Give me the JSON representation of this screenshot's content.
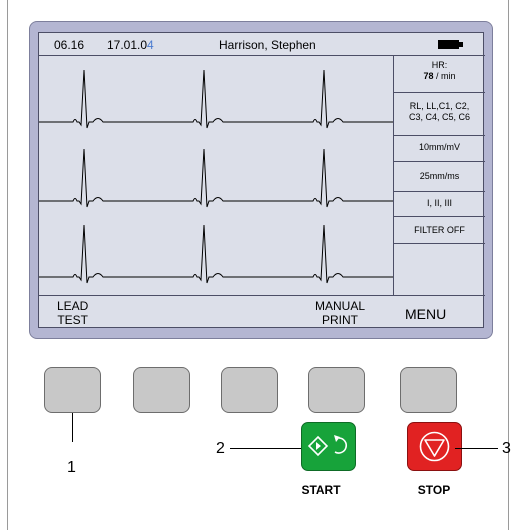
{
  "status": {
    "time": "06.16",
    "date_main": "17.01.0",
    "date_last": "4",
    "patient": "Harrison, Stephen"
  },
  "params": {
    "hr_label": "HR:",
    "hr_value": "78",
    "hr_unit": " / min",
    "leads_line1": "RL, LL,C1, C2,",
    "leads_line2": "C3, C4, C5, C6",
    "sensitivity": "10mm/mV",
    "speed": "25mm/ms",
    "lead_set": "I, II, III",
    "filter": "FILTER OFF"
  },
  "softkeys": {
    "lead_test_line1": "LEAD",
    "lead_test_line2": "TEST",
    "manual_print_line1": "MANUAL",
    "manual_print_line2": "PRINT",
    "menu": "MENU"
  },
  "buttons": {
    "start": "START",
    "stop": "STOP"
  },
  "callouts": {
    "one": "1",
    "two": "2",
    "three": "3"
  },
  "colors": {
    "screen_bg": "#dcdfe9",
    "frame": "#b4b6d2",
    "start": "#17a33a",
    "stop": "#e12222"
  }
}
